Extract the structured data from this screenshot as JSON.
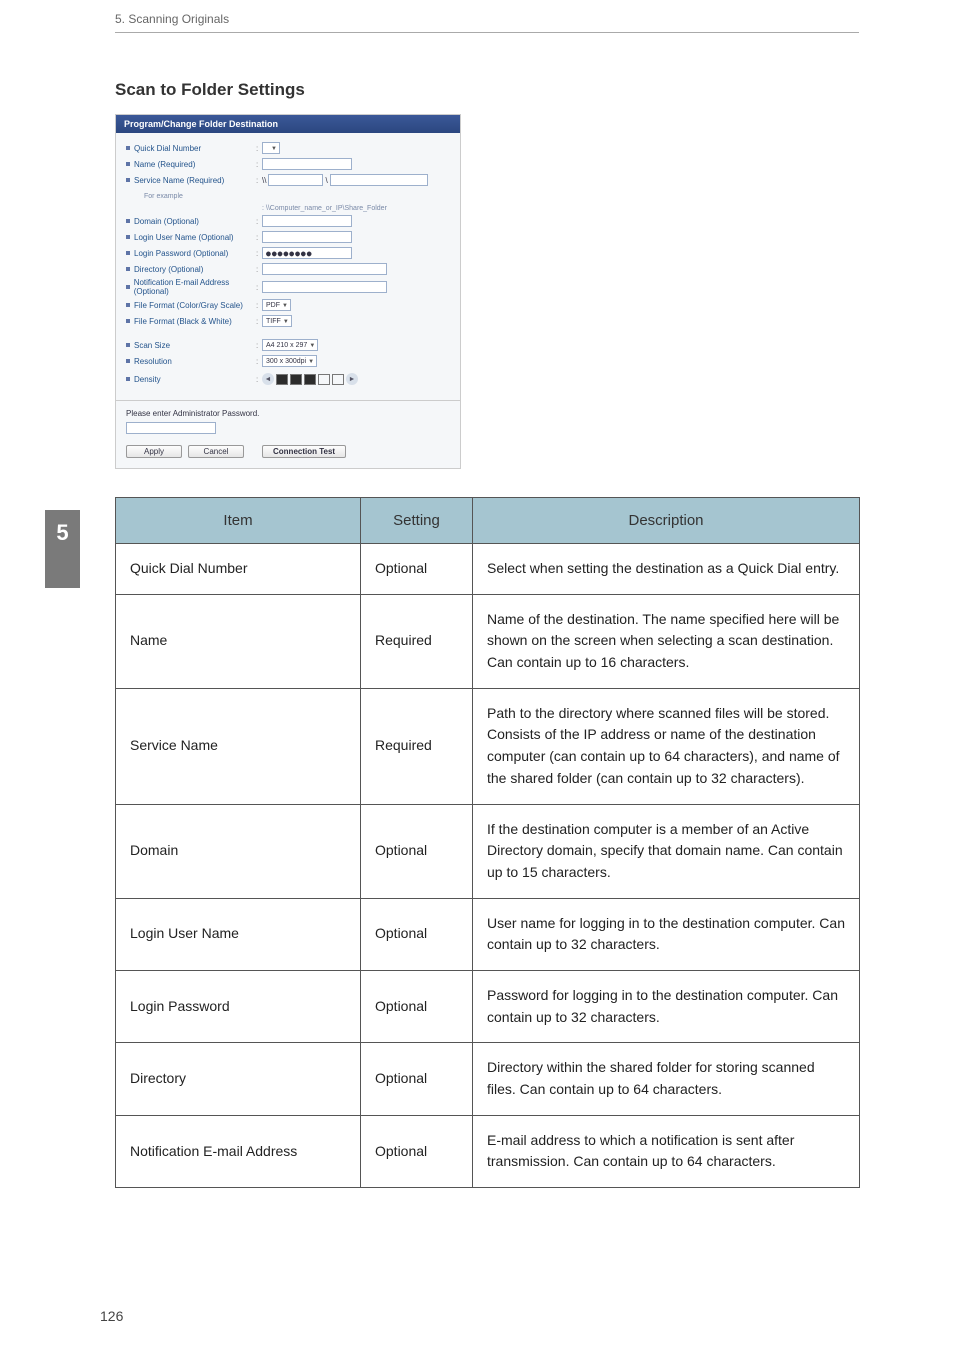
{
  "header": {
    "breadcrumb": "5. Scanning Originals"
  },
  "chapter": {
    "number": "5"
  },
  "page": {
    "number": "126"
  },
  "section": {
    "title": "Scan to Folder Settings"
  },
  "panel": {
    "title": "Program/Change Folder Destination",
    "rows": {
      "quick_dial": {
        "label": "Quick Dial Number"
      },
      "name": {
        "label": "Name (Required)"
      },
      "service": {
        "label": "Service Name (Required)",
        "prefix": "\\\\",
        "mid": "\\"
      },
      "example_label": "For example",
      "example_path": ": \\\\Computer_name_or_IP\\Share_Folder",
      "domain": {
        "label": "Domain (Optional)"
      },
      "login_user": {
        "label": "Login User Name (Optional)"
      },
      "login_pass": {
        "label": "Login Password (Optional)",
        "value": "●●●●●●●●"
      },
      "directory": {
        "label": "Directory (Optional)"
      },
      "notify": {
        "label": "Notification E-mail Address (Optional)"
      },
      "ff_color": {
        "label": "File Format (Color/Gray Scale)",
        "value": "PDF"
      },
      "ff_bw": {
        "label": "File Format (Black & White)",
        "value": "TIFF"
      },
      "scan_size": {
        "label": "Scan Size",
        "value": "A4 210 x 297"
      },
      "resolution": {
        "label": "Resolution",
        "value": "300 x 300dpi"
      },
      "density": {
        "label": "Density"
      }
    },
    "footer": {
      "prompt": "Please enter Administrator Password.",
      "apply": "Apply",
      "cancel": "Cancel",
      "test": "Connection Test"
    }
  },
  "table": {
    "headers": {
      "item": "Item",
      "setting": "Setting",
      "desc": "Description"
    },
    "rows": [
      {
        "item": "Quick Dial Number",
        "setting": "Optional",
        "desc": "Select when setting the destination as a Quick Dial entry."
      },
      {
        "item": "Name",
        "setting": "Required",
        "desc": "Name of the destination. The name specified here will be shown on the screen when selecting a scan destination. Can contain up to 16 characters."
      },
      {
        "item": "Service Name",
        "setting": "Required",
        "desc": "Path to the directory where scanned files will be stored. Consists of the IP address or name of the destination computer (can contain up to 64 characters), and name of the shared folder (can contain up to 32 characters)."
      },
      {
        "item": "Domain",
        "setting": "Optional",
        "desc": "If the destination computer is a member of an Active Directory domain, specify that domain name. Can contain up to 15 characters."
      },
      {
        "item": "Login User Name",
        "setting": "Optional",
        "desc": "User name for logging in to the destination computer. Can contain up to 32 characters."
      },
      {
        "item": "Login Password",
        "setting": "Optional",
        "desc": "Password for logging in to the destination computer. Can contain up to 32 characters."
      },
      {
        "item": "Directory",
        "setting": "Optional",
        "desc": "Directory within the shared folder for storing scanned files. Can contain up to 64 characters."
      },
      {
        "item": "Notification E-mail Address",
        "setting": "Optional",
        "desc": "E-mail address to which a notification is sent after transmission. Can contain up to 64 characters."
      }
    ]
  }
}
